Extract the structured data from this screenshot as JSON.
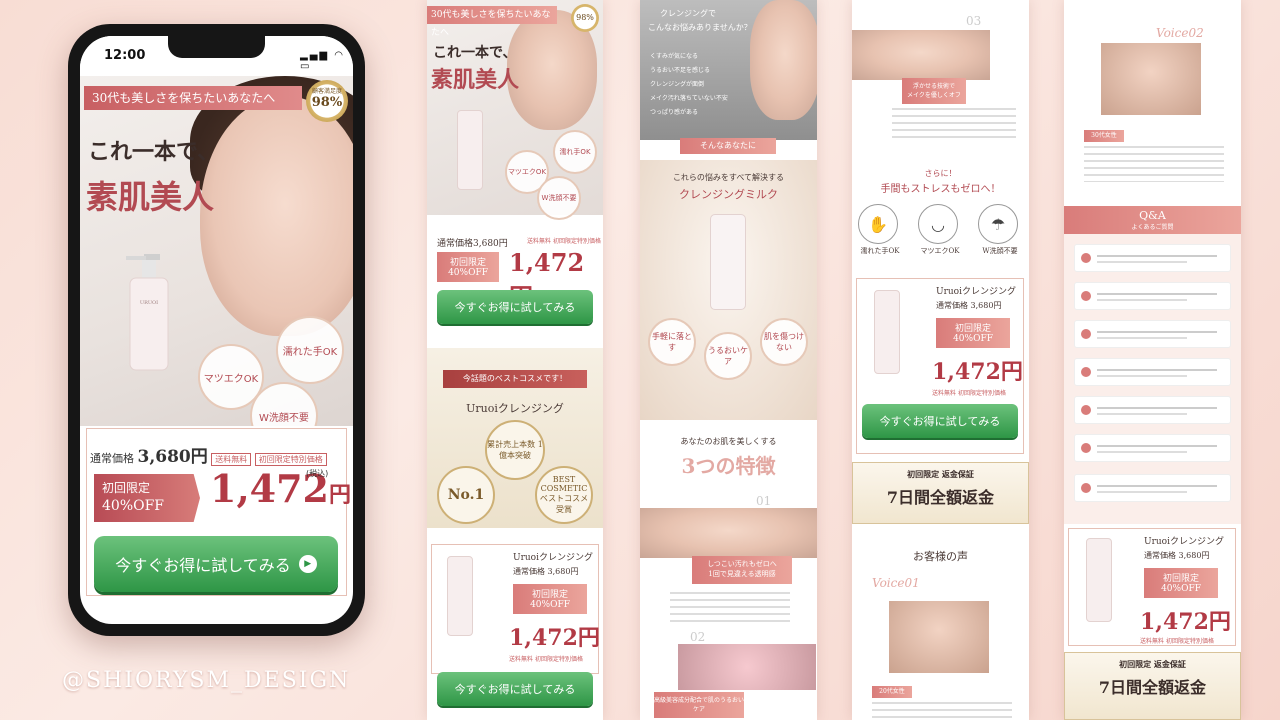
{
  "phone": {
    "status_time": "12:00",
    "banner": "30代も美しさを保ちたいあなたへ",
    "badge_label": "顧客満足度",
    "badge_value": "98%",
    "catch_line1": "これ一本で、",
    "catch_line2": "素肌美人",
    "features": [
      "マツエクOK",
      "濡れた手OK",
      "W洗顔不要"
    ],
    "regular_label": "通常価格",
    "regular_price": "3,680円",
    "tags": [
      "送料無料",
      "初回限定特別価格"
    ],
    "discount_line1": "初回限定",
    "discount_line2": "40%OFF",
    "sale_price": "1,472",
    "sale_unit": "円",
    "tax_note": "(税込)",
    "cta": "今すぐお得に試してみる"
  },
  "handle": "@SHIORYSM_DESIGN",
  "col1": {
    "banner": "30代も美しさを保ちたいあなたへ",
    "catch_line1": "これ一本で、",
    "catch_line2": "素肌美人",
    "features": [
      "マツエクOK",
      "濡れ手OK",
      "W洗顔不要"
    ],
    "regular": "通常価格3,680円",
    "tags": [
      "送料無料",
      "初回限定特別価格"
    ],
    "discount": "初回限定 40%OFF",
    "price": "1,472円",
    "cta": "今すぐお得に試してみる",
    "ribbon": "今話題のベストコスメです！",
    "product_name": "Uruoiクレンジング",
    "medal1": "累計売上本数 1億本突破",
    "medal2": "No.1",
    "medal3": "BEST COSMETIC ベストコスメ受賞",
    "box_name": "Uruoiクレンジング",
    "box_regular": "通常価格 3,680円",
    "box_discount": "初回限定 40%OFF",
    "box_price": "1,472円",
    "box_tags": [
      "送料無料",
      "初回限定特別価格"
    ],
    "cta2": "今すぐお得に試してみる"
  },
  "col2": {
    "header1": "クレンジングで",
    "header2": "こんなお悩みありませんか？",
    "worries": [
      "くすみが気になる",
      "うるおい不足を感じる",
      "クレンジングが面倒",
      "メイク汚れ落ちていない不安",
      "つっぱり感がある"
    ],
    "band": "そんなあなたに",
    "solve1": "これらの悩みをすべて解決する",
    "solve2": "クレンジングミルク",
    "circles": [
      "手軽に落とす",
      "うるおいケア",
      "肌を傷つけない"
    ],
    "feat_intro": "あなたのお肌を美しくする",
    "feat_title": "3つの特徴",
    "num1": "01",
    "point1a": "しつこい汚れもゼロへ",
    "point1b": "1回で見違える透明感",
    "num2": "02",
    "point2": "高級美容成分配合で肌のうるおいケア"
  },
  "col3": {
    "num3": "03",
    "point3a": "浮かせる技術で",
    "point3b": "メイクを優しくオフ",
    "stress1": "さらに！",
    "stress2": "手間もストレスもゼロへ！",
    "icons": [
      "濡れた手OK",
      "マツエクOK",
      "W洗顔不要"
    ],
    "box_name": "Uruoiクレンジング",
    "box_regular": "通常価格 3,680円",
    "box_discount": "初回限定 40%OFF",
    "box_price": "1,472円",
    "box_tags": [
      "送料無料",
      "初回限定特別価格"
    ],
    "cta": "今すぐお得に試してみる",
    "guarantee_small": "初回限定 返金保証",
    "guarantee": "7日間全額返金",
    "voice_title": "お客様の声",
    "voice_label": "Voice01",
    "voice_age": "20代女性"
  },
  "col4": {
    "voice_label": "Voice02",
    "voice_age": "30代女性",
    "qa_title": "Q&A",
    "qa_sub": "よくあるご質問",
    "box_name": "Uruoiクレンジング",
    "box_regular": "通常価格 3,680円",
    "box_discount": "初回限定 40%OFF",
    "box_price": "1,472円",
    "box_tags": [
      "送料無料",
      "初回限定特別価格"
    ],
    "guarantee_small": "初回限定 返金保証",
    "guarantee": "7日間全額返金"
  }
}
